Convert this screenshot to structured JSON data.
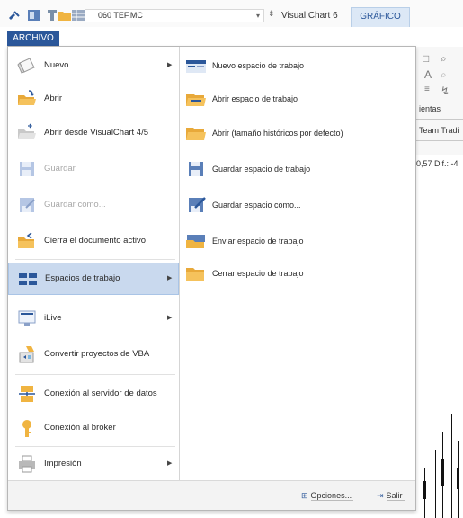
{
  "quick_access": {
    "symbol_value": "060 TEF.MC",
    "icons": [
      "pin-icon",
      "layout-icon",
      "tool-icon",
      "folder-icon",
      "grid-icon"
    ],
    "extra_glyph": "⇟"
  },
  "app_title": "Visual Chart 6",
  "ribbon_tab": "GRÁFICO",
  "file_tab": "ARCHIVO",
  "ribbon_background": {
    "fragment_text": "ientas",
    "team_text": "Team Tradi",
    "value_text": "0,57  Dif.: -4"
  },
  "menu": {
    "items": [
      {
        "label": "Nuevo",
        "icon": "new-document-icon",
        "submenu": true,
        "disabled": false
      },
      {
        "label": "Abrir",
        "icon": "open-folder-icon",
        "submenu": false,
        "disabled": false
      },
      {
        "label": "Abrir desde VisualChart 4/5",
        "icon": "open-legacy-icon",
        "submenu": false,
        "disabled": false
      },
      {
        "label": "Guardar",
        "icon": "save-icon",
        "submenu": false,
        "disabled": true
      },
      {
        "label": "Guardar como...",
        "icon": "save-as-icon",
        "submenu": false,
        "disabled": true
      },
      {
        "label": "Cierra el documento activo",
        "icon": "close-document-icon",
        "submenu": false,
        "disabled": false
      },
      {
        "label": "Espacios de trabajo",
        "icon": "workspaces-icon",
        "submenu": true,
        "disabled": false,
        "active": true
      },
      {
        "label": "iLive",
        "icon": "ilive-icon",
        "submenu": true,
        "disabled": false
      },
      {
        "label": "Convertir proyectos de VBA",
        "icon": "convert-vba-icon",
        "submenu": false,
        "disabled": false
      },
      {
        "label": "Conexión al servidor de datos",
        "icon": "data-server-icon",
        "submenu": false,
        "disabled": false
      },
      {
        "label": "Conexión al broker",
        "icon": "broker-icon",
        "submenu": false,
        "disabled": false
      },
      {
        "label": "Impresión",
        "icon": "printer-icon",
        "submenu": true,
        "disabled": false
      }
    ],
    "submenu_items": [
      {
        "label": "Nuevo espacio de trabajo",
        "icon": "new-workspace-icon"
      },
      {
        "label": "Abrir espacio de trabajo",
        "icon": "open-workspace-icon"
      },
      {
        "label": "Abrir (tamaño históricos por defecto)",
        "icon": "open-workspace-default-icon"
      },
      {
        "label": "Guardar espacio de trabajo",
        "icon": "save-workspace-icon"
      },
      {
        "label": "Guardar espacio como...",
        "icon": "save-workspace-as-icon"
      },
      {
        "label": "Enviar espacio de trabajo",
        "icon": "send-workspace-icon"
      },
      {
        "label": "Cerrar espacio de trabajo",
        "icon": "close-workspace-icon"
      }
    ],
    "footer": {
      "options_label": "Opciones...",
      "exit_label": "Salir"
    }
  },
  "colors": {
    "accent": "#2b579a",
    "active_item_bg": "#c9d9ee",
    "folder": "#f0b441",
    "disabled_icon": "#9ab0d6"
  }
}
